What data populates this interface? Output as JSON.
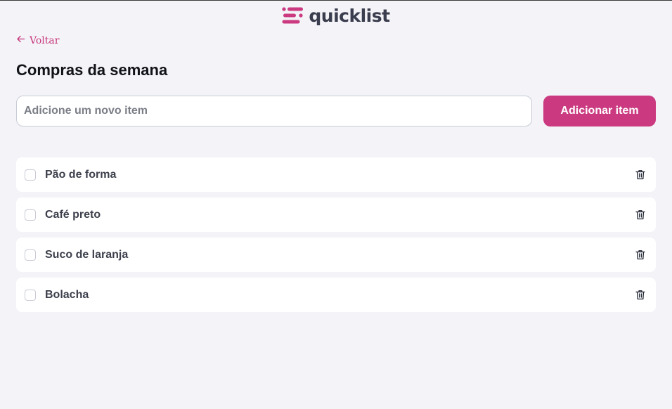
{
  "header": {
    "logo_icon": "list-lines-icon",
    "app_name": "quicklist",
    "brand_color": "#cb3a80"
  },
  "nav": {
    "back_icon": "arrow-left-icon",
    "back_label": "Voltar"
  },
  "page": {
    "title": "Compras da semana"
  },
  "form": {
    "input_value": "",
    "input_placeholder": "Adicione um novo item",
    "add_button_label": "Adicionar item"
  },
  "items": [
    {
      "label": "Pão de forma",
      "checked": false,
      "delete_icon": "trash-icon"
    },
    {
      "label": "Café preto",
      "checked": false,
      "delete_icon": "trash-icon"
    },
    {
      "label": "Suco de laranja",
      "checked": false,
      "delete_icon": "trash-icon"
    },
    {
      "label": "Bolacha",
      "checked": false,
      "delete_icon": "trash-icon"
    }
  ]
}
